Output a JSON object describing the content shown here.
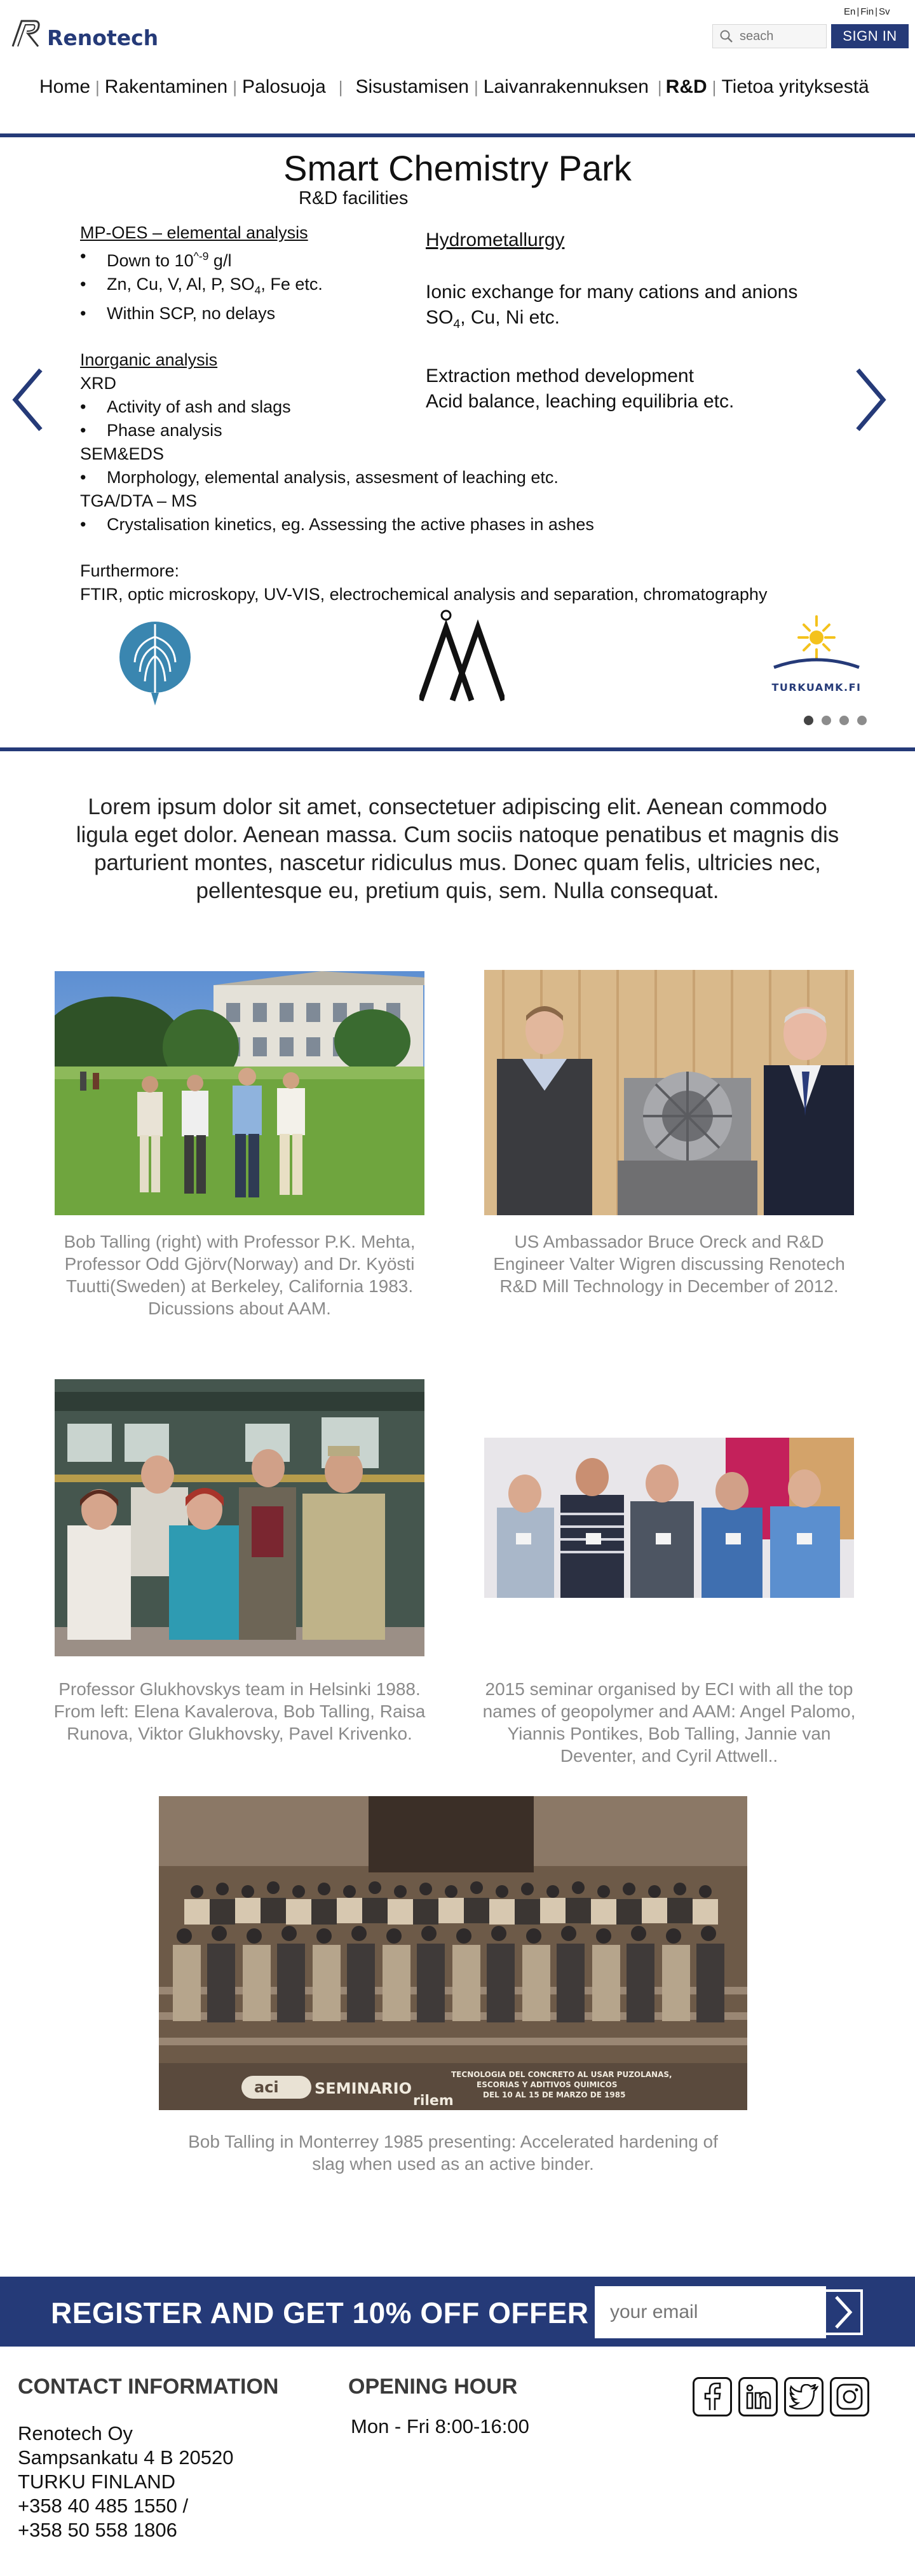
{
  "brand": {
    "name": "Renotech",
    "color": "#253a78"
  },
  "languages": [
    "En",
    "Fin",
    "Sv"
  ],
  "search": {
    "placeholder": "seach"
  },
  "signin_label": "SIGN IN",
  "nav": [
    {
      "label": "Home"
    },
    {
      "label": "Rakentaminen"
    },
    {
      "label": "Palosuoja"
    },
    {
      "label": "Sisustamisen"
    },
    {
      "label": "Laivanrakennuksen"
    },
    {
      "label": "R&D"
    },
    {
      "label": "Tietoa yrityksestä"
    }
  ],
  "slide": {
    "title": "Smart Chemistry Park",
    "subtitle": "R&D facilities",
    "mp_heading": "MP-OES – elemental analysis",
    "mp_items": [
      "Down to 10^-9 g/l",
      "Zn, Cu, V, Al, P, SO4, Fe etc.",
      "Within SCP, no delays"
    ],
    "inorganic_heading": "Inorganic analysis",
    "xrd_label": "XRD",
    "xrd_items": [
      "Activity of ash and slags",
      "Phase analysis"
    ],
    "sem_label": "SEM&EDS",
    "sem_items": [
      "Morphology, elemental analysis, assesment of leaching etc."
    ],
    "tga_label": "TGA/DTA – MS",
    "tga_items": [
      "Crystalisation kinetics, eg. Assessing the active phases in ashes"
    ],
    "further_label": "Furthermore:",
    "further_text": "FTIR, optic microskopy, UV-VIS, electrochemical analysis and separation, chromatography",
    "hydro_heading": "Hydrometallurgy",
    "hydro_line1": "Ionic exchange for many cations and anions",
    "hydro_line2": "SO4, Cu, Ni etc.",
    "hydro_line3": "Extraction method development",
    "hydro_line4": "Acid balance, leaching equilibria etc.",
    "partner_label": "TURKUAMK.FI",
    "slide_count": 4,
    "active_slide": 1
  },
  "intro_text": "Lorem ipsum dolor sit amet, consectetuer adipiscing elit. Aenean commodo ligula eget dolor. Aenean massa. Cum sociis natoque penatibus et magnis dis parturient montes, nascetur ridiculus mus. Donec quam felis, ultricies nec, pellentesque eu, pretium quis, sem. Nulla consequat.",
  "photos": [
    {
      "caption": "Bob Talling (right) with Professor P.K. Mehta, Professor Odd Gjörv(Norway) and Dr. Kyösti Tuutti(Sweden) at Berkeley, California 1983. Dicussions about AAM."
    },
    {
      "caption": "US Ambassador Bruce Oreck and R&D Engineer Valter Wigren discussing Renotech R&D Mill Technology in December of 2012."
    },
    {
      "caption": "Professor Glukhovskys team in Helsinki 1988. From left: Elena Kavalerova, Bob Talling, Raisa Runova, Viktor Glukhovsky, Pavel Krivenko."
    },
    {
      "caption": "2015 seminar organised by ECI with all the top names of geopolymer and AAM: Angel Palomo, Yiannis Pontikes, Bob Talling, Jannie van Deventer, and Cyril Attwell.."
    },
    {
      "caption": "Bob Talling in Monterrey 1985 presenting: Accelerated hardening of slag when used as an active binder.",
      "banner_line1": "TECNOLOGIA DEL CONCRETO AL USAR PUZOLANAS,",
      "banner_line2": "ESCORIAS Y ADITIVOS QUIMICOS",
      "banner_line3": "DEL 10 AL 15 DE MARZO DE 1985",
      "banner_aci": "aci",
      "banner_seminario": "SEMINARIO",
      "banner_brand": "rilem"
    }
  ],
  "register": {
    "text": "REGISTER AND GET 10% OFF OFFER",
    "placeholder": "your email"
  },
  "footer": {
    "contact_heading": "CONTACT INFORMATION",
    "hours_heading": "OPENING HOUR",
    "company": "Renotech Oy",
    "street": "Sampsankatu 4 B 20520",
    "city": "TURKU FINLAND",
    "phone1": "+358 40 485 1550 /",
    "phone2": "+358 50 558 1806",
    "hours": "Mon - Fri  8:00-16:00"
  },
  "social": [
    "facebook-icon",
    "linkedin-icon",
    "twitter-icon",
    "instagram-icon"
  ]
}
